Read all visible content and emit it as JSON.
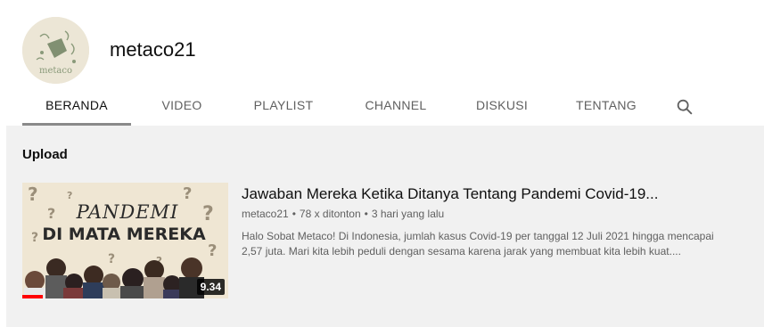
{
  "channel": {
    "name": "metaco21",
    "avatar_text": "metaco"
  },
  "tabs": [
    {
      "label": "BERANDA",
      "active": true
    },
    {
      "label": "VIDEO",
      "active": false
    },
    {
      "label": "PLAYLIST",
      "active": false
    },
    {
      "label": "CHANNEL",
      "active": false
    },
    {
      "label": "DISKUSI",
      "active": false
    },
    {
      "label": "TENTANG",
      "active": false
    }
  ],
  "section": {
    "title": "Upload"
  },
  "video": {
    "title": "Jawaban Mereka Ketika Ditanya Tentang Pandemi Covid-19...",
    "channel": "metaco21",
    "views": "78 x ditonton",
    "age": "3 hari yang lalu",
    "byline_separator": "•",
    "description": "Halo Sobat Metaco! Di Indonesia, jumlah kasus Covid-19 per tanggal 12 Juli 2021 hingga mencapai 2,57 juta. Mari kita lebih peduli dengan sesama karena jarak yang membuat kita lebih kuat....",
    "duration": "9.34",
    "watched_fraction": 0.1,
    "thumbnail": {
      "line1": "PANDEMI",
      "line2": "DI MATA MEREKA"
    }
  },
  "icons": {
    "search": "search-icon"
  },
  "colors": {
    "accent_red": "#ff0000",
    "tab_underline": "#8a8a8a",
    "content_bg": "#f1f1f1"
  }
}
